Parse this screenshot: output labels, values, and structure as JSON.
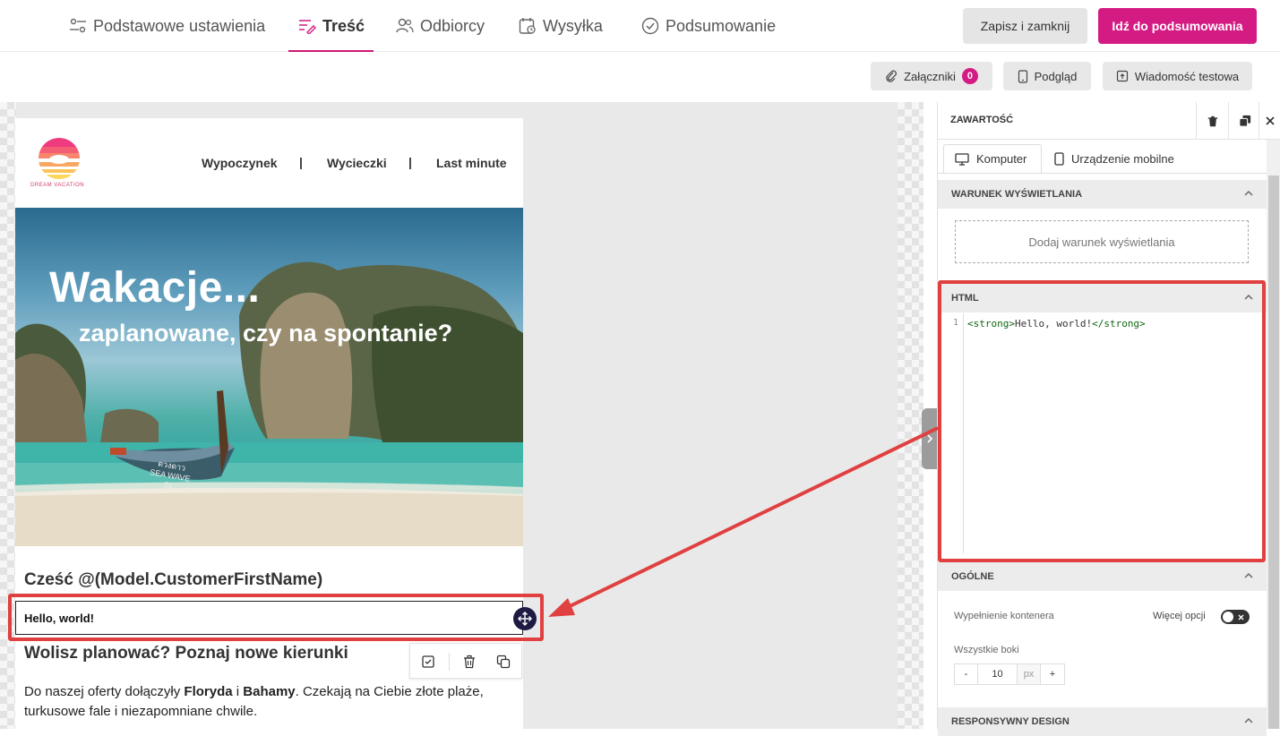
{
  "steps": [
    {
      "label": "Podstawowe ustawienia",
      "icon": "sliders-icon"
    },
    {
      "label": "Treść",
      "icon": "content-icon",
      "active": true
    },
    {
      "label": "Odbiorcy",
      "icon": "users-icon"
    },
    {
      "label": "Wysyłka",
      "icon": "calendar-icon"
    },
    {
      "label": "Podsumowanie",
      "icon": "check-circle-icon"
    }
  ],
  "header": {
    "save_close": "Zapisz i zamknij",
    "go_summary": "Idź do podsumowania"
  },
  "toolbar": {
    "attachments": "Załączniki",
    "attachments_count": "0",
    "preview": "Podgląd",
    "test_message": "Wiadomość testowa"
  },
  "email": {
    "logo_text": "DREAM VACATION",
    "nav": [
      "Wypoczynek",
      "Wycieczki",
      "Last minute"
    ],
    "nav_separator": "|",
    "hero_title": "Wakacje...",
    "hero_subtitle": "zaplanowane, czy na spontanie?",
    "boat_text_1": "ดวงดาว",
    "boat_text_2": "SEA WAVE",
    "boat_number": "21",
    "greeting": "Cześć @(Model.CustomerFirstName)",
    "html_block_text": "Hello, world!",
    "heading2": "Wolisz planować? Poznaj nowe kierunki",
    "para_part1": "Do naszej oferty dołączyły ",
    "para_bold1": "Floryda",
    "para_part2": " i ",
    "para_bold2": "Bahamy",
    "para_part3": ". Czekają na Ciebie złote plaże, turkusowe fale i niezapomniane chwile."
  },
  "sidebar": {
    "title": "ZAWARTOŚĆ",
    "tabs": [
      {
        "label": "Komputer",
        "icon": "desktop-icon"
      },
      {
        "label": "Urządzenie mobilne",
        "icon": "mobile-icon"
      }
    ],
    "condition_section": "WARUNEK WYŚWIETLANIA",
    "add_condition": "Dodaj warunek wyświetlania",
    "html_section": "HTML",
    "code_line_number": "1",
    "code_tag_open": "<strong>",
    "code_text": "Hello, world!",
    "code_tag_close": "</strong>",
    "general_section": "OGÓLNE",
    "container_padding": "Wypełnienie kontenera",
    "more_options": "Więcej opcji",
    "all_sides": "Wszystkie boki",
    "stepper_minus": "-",
    "padding_value": "10",
    "padding_unit": "px",
    "stepper_plus": "+",
    "responsive_section": "RESPONSYWNY DESIGN"
  },
  "colors": {
    "accent": "#d41a83",
    "highlight_red": "#e04040",
    "handle": "#1d1a44"
  }
}
